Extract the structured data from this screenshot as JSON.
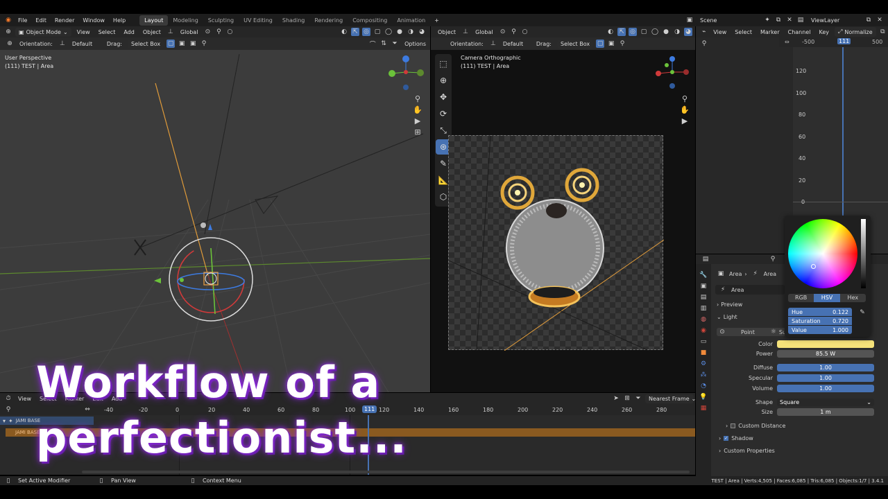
{
  "menu": [
    "File",
    "Edit",
    "Render",
    "Window",
    "Help"
  ],
  "workspaces": [
    {
      "label": "Layout",
      "active": true
    },
    {
      "label": "Modeling"
    },
    {
      "label": "Sculpting"
    },
    {
      "label": "UV Editing"
    },
    {
      "label": "Shading"
    },
    {
      "label": "Rendering"
    },
    {
      "label": "Compositing"
    },
    {
      "label": "Animation"
    }
  ],
  "scene": {
    "name": "Scene",
    "view_layer": "ViewLayer"
  },
  "viewport_left": {
    "mode": "Object Mode",
    "menus": [
      "View",
      "Select",
      "Add",
      "Object"
    ],
    "orientation_transform": "Global",
    "orientation_label": "Orientation:",
    "orientation_value": "Default",
    "drag_label": "Drag:",
    "drag_value": "Select Box",
    "options": "Options",
    "hud_line1": "User Perspective",
    "hud_line2": "(111) TEST | Area"
  },
  "viewport_right": {
    "menus": [
      "Object"
    ],
    "orientation_transform": "Global",
    "orientation_label": "Orientation:",
    "orientation_value": "Default",
    "drag_label": "Drag:",
    "drag_value": "Select Box",
    "hud_line1": "Camera Orthographic",
    "hud_line2": "(111) TEST | Area"
  },
  "graph": {
    "menus": [
      "View",
      "Select",
      "Marker",
      "Channel",
      "Key"
    ],
    "normalize": "Normalize",
    "ruler": [
      "-500",
      "111",
      "500"
    ],
    "y_ticks": [
      "120",
      "100",
      "80",
      "60",
      "40",
      "20",
      "0"
    ]
  },
  "color_picker": {
    "tabs": [
      {
        "label": "RGB"
      },
      {
        "label": "HSV",
        "active": true
      },
      {
        "label": "Hex"
      }
    ],
    "hue": {
      "label": "Hue",
      "value": "0.122"
    },
    "saturation": {
      "label": "Saturation",
      "value": "0.720"
    },
    "value": {
      "label": "Value",
      "value": "1.000"
    }
  },
  "properties": {
    "breadcrumb": [
      "Area",
      "Area"
    ],
    "data_name": "Area",
    "sections": {
      "preview": "Preview",
      "light": "Light",
      "custom_distance": "Custom Distance",
      "shadow": "Shadow",
      "custom_properties": "Custom Properties"
    },
    "light_types": [
      "Point",
      "Su"
    ],
    "rows": [
      {
        "label": "Color",
        "value": "",
        "kind": "color"
      },
      {
        "label": "Power",
        "value": "85.5 W",
        "kind": "plain"
      },
      {
        "label": "Diffuse",
        "value": "1.00",
        "kind": "blue"
      },
      {
        "label": "Specular",
        "value": "1.00",
        "kind": "blue"
      },
      {
        "label": "Volume",
        "value": "1.00",
        "kind": "blue"
      },
      {
        "label": "Shape",
        "value": "Square",
        "kind": "select"
      },
      {
        "label": "Size",
        "value": "1 m",
        "kind": "plain"
      }
    ],
    "light_color": "#f5e27a"
  },
  "timeline": {
    "menus": [
      "View",
      "Select",
      "Marker",
      "Edit",
      "Add"
    ],
    "interpolation": "Nearest Frame",
    "ticks": [
      "-40",
      "-20",
      "0",
      "20",
      "40",
      "60",
      "80",
      "100",
      "111",
      "120",
      "140",
      "160",
      "180",
      "200",
      "220",
      "240",
      "260",
      "280"
    ],
    "current_frame": "111",
    "channels": [
      "JAMI BASE",
      "JAMI BASE"
    ]
  },
  "status": {
    "left": "Set Active Modifier",
    "mid": "Pan View",
    "ctx": "Context Menu",
    "right": "TEST | Area | Verts:4,505 | Faces:6,085 | Tris:6,085 | Objects:1/7 | 3.4.1"
  },
  "overlay_title": {
    "line1": "Workflow of a",
    "line2": "perfectionist..."
  },
  "accent": "#4772b3"
}
